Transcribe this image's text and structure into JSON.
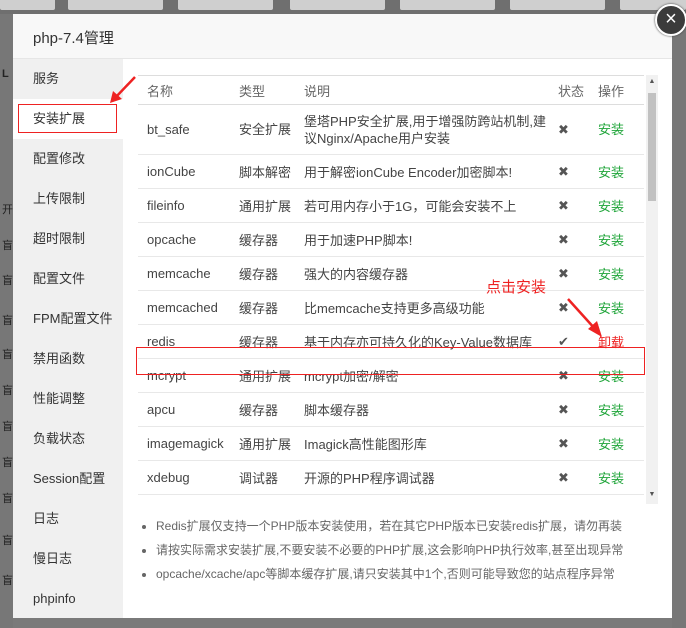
{
  "dialog": {
    "title": "php-7.4管理",
    "close_label": "×"
  },
  "sidebar": {
    "items": [
      {
        "label": "服务"
      },
      {
        "label": "安装扩展"
      },
      {
        "label": "配置修改"
      },
      {
        "label": "上传限制"
      },
      {
        "label": "超时限制"
      },
      {
        "label": "配置文件"
      },
      {
        "label": "FPM配置文件"
      },
      {
        "label": "禁用函数"
      },
      {
        "label": "性能调整"
      },
      {
        "label": "负载状态"
      },
      {
        "label": "Session配置"
      },
      {
        "label": "日志"
      },
      {
        "label": "慢日志"
      },
      {
        "label": "phpinfo"
      }
    ]
  },
  "table": {
    "headers": {
      "name": "名称",
      "type": "类型",
      "desc": "说明",
      "status": "状态",
      "action": "操作"
    },
    "rows": [
      {
        "name": "bt_safe",
        "type": "安全扩展",
        "desc": "堡塔PHP安全扩展,用于增强防跨站机制,建议Nginx/Apache用户安装",
        "status": "✖",
        "action": "安装"
      },
      {
        "name": "ionCube",
        "type": "脚本解密",
        "desc": "用于解密ionCube Encoder加密脚本!",
        "status": "✖",
        "action": "安装"
      },
      {
        "name": "fileinfo",
        "type": "通用扩展",
        "desc": "若可用内存小于1G，可能会安装不上",
        "status": "✖",
        "action": "安装"
      },
      {
        "name": "opcache",
        "type": "缓存器",
        "desc": "用于加速PHP脚本!",
        "status": "✖",
        "action": "安装"
      },
      {
        "name": "memcache",
        "type": "缓存器",
        "desc": "强大的内容缓存器",
        "status": "✖",
        "action": "安装"
      },
      {
        "name": "memcached",
        "type": "缓存器",
        "desc": "比memcache支持更多高级功能",
        "status": "✖",
        "action": "安装"
      },
      {
        "name": "redis",
        "type": "缓存器",
        "desc": "基于内存亦可持久化的Key-Value数据库",
        "status": "✔",
        "action": "卸载"
      },
      {
        "name": "mcrypt",
        "type": "通用扩展",
        "desc": "mcrypt加密/解密",
        "status": "✖",
        "action": "安装"
      },
      {
        "name": "apcu",
        "type": "缓存器",
        "desc": "脚本缓存器",
        "status": "✖",
        "action": "安装"
      },
      {
        "name": "imagemagick",
        "type": "通用扩展",
        "desc": "Imagick高性能图形库",
        "status": "✖",
        "action": "安装"
      },
      {
        "name": "xdebug",
        "type": "调试器",
        "desc": "开源的PHP程序调试器",
        "status": "✖",
        "action": "安装"
      }
    ]
  },
  "notes": [
    "Redis扩展仅支持一个PHP版本安装使用，若在其它PHP版本已安装redis扩展，请勿再装",
    "请按实际需求安装扩展,不要安装不必要的PHP扩展,这会影响PHP执行效率,甚至出现异常",
    "opcache/xcache/apc等脚本缓存扩展,请只安装其中1个,否则可能导致您的站点程序异常"
  ],
  "annotation": {
    "text": "点击安装"
  },
  "background": {
    "marks": [
      "L",
      "开",
      "盲",
      "盲",
      "盲",
      "盲",
      "盲",
      "盲",
      "盲",
      "盲",
      "盲",
      "盲"
    ]
  },
  "colors": {
    "install": "#20a53a",
    "uninstall": "#e22222",
    "highlight": "#e22222"
  }
}
